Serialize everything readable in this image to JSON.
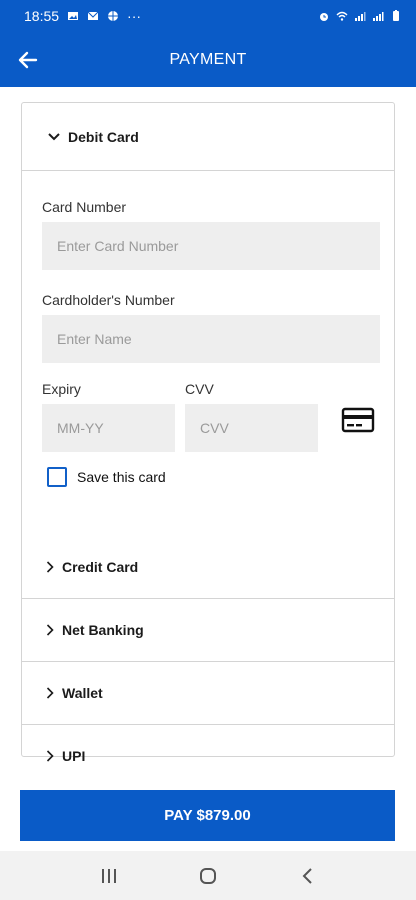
{
  "status_bar": {
    "time": "18:55",
    "more": "···"
  },
  "header": {
    "title": "PAYMENT"
  },
  "debit_card": {
    "title": "Debit Card",
    "card_number_label": "Card Number",
    "card_number_placeholder": "Enter Card Number",
    "cardholder_label": "Cardholder's Number",
    "cardholder_placeholder": "Enter Name",
    "expiry_label": "Expiry",
    "expiry_placeholder": "MM-YY",
    "cvv_label": "CVV",
    "cvv_placeholder": "CVV",
    "save_card_label": "Save this card",
    "save_card_checked": false
  },
  "payment_methods": [
    {
      "label": "Credit Card"
    },
    {
      "label": "Net Banking"
    },
    {
      "label": "Wallet"
    },
    {
      "label": "UPI"
    }
  ],
  "pay_button": {
    "label": "PAY $879.00"
  },
  "colors": {
    "primary": "#0a5bc7",
    "input_bg": "#eeeeee",
    "border": "#d4d4d4"
  }
}
